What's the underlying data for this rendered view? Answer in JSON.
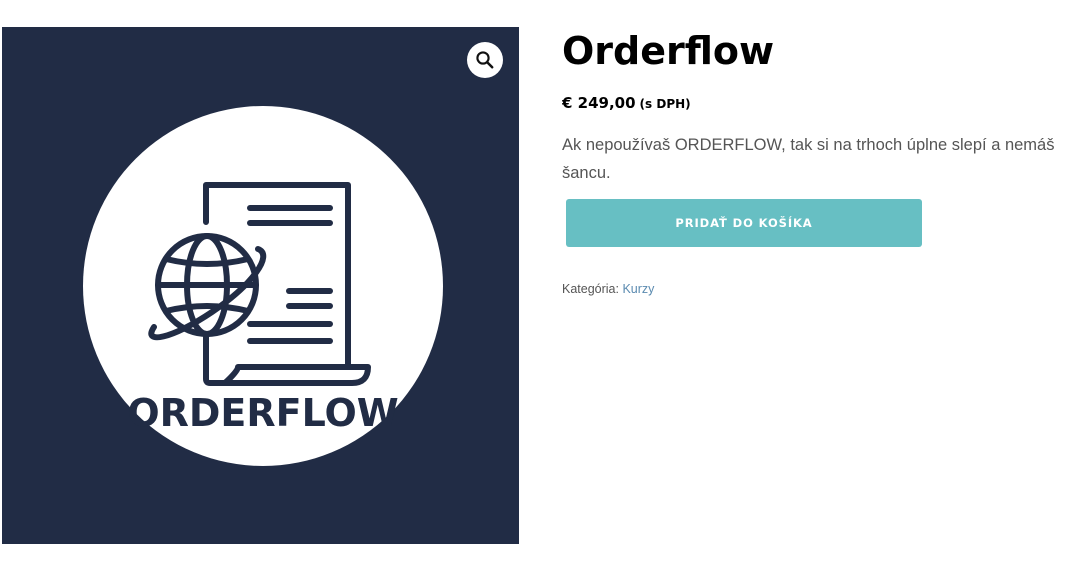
{
  "product": {
    "title": "Orderflow",
    "price": "€ 249,00",
    "price_suffix": "(s DPH)",
    "description": "Ak nepoužívaš ORDERFLOW, tak si na trhoch úplne slepí a nemáš šancu.",
    "add_to_cart_label": "PRIDAŤ DO KOŠÍKA",
    "category_label": "Kategória:",
    "category_link": "Kurzy"
  },
  "gallery": {
    "logo_text": "ORDERFLOW",
    "zoom_icon": "magnifier-icon"
  },
  "colors": {
    "image_background": "#212c45",
    "logo_circle": "#ffffff",
    "logo_ink": "#212c45",
    "button": "#67bfc3",
    "link": "#5b8bb0",
    "text_muted": "#555555"
  }
}
